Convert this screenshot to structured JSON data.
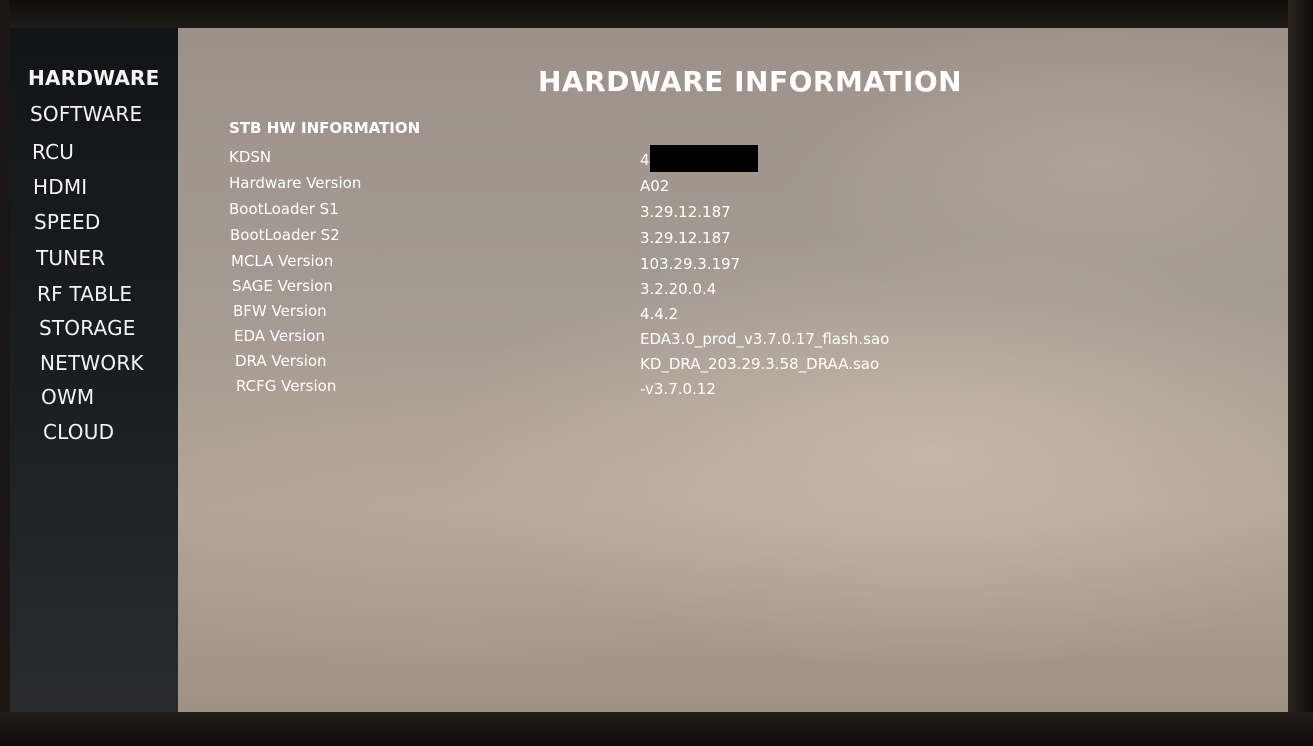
{
  "sidebar": {
    "items": [
      {
        "label": "HARDWARE",
        "active": true
      },
      {
        "label": "SOFTWARE"
      },
      {
        "label": "RCU"
      },
      {
        "label": "HDMI"
      },
      {
        "label": "SPEED"
      },
      {
        "label": "TUNER"
      },
      {
        "label": "RF TABLE"
      },
      {
        "label": "STORAGE"
      },
      {
        "label": "NETWORK"
      },
      {
        "label": "OWM"
      },
      {
        "label": "CLOUD"
      }
    ]
  },
  "page": {
    "title": "HARDWARE INFORMATION"
  },
  "section": {
    "title": "STB HW INFORMATION",
    "rows": [
      {
        "label": "KDSN",
        "value": "4"
      },
      {
        "label": "Hardware Version",
        "value": "A02"
      },
      {
        "label": "BootLoader S1",
        "value": "3.29.12.187"
      },
      {
        "label": "BootLoader S2",
        "value": "3.29.12.187"
      },
      {
        "label": "MCLA Version",
        "value": "103.29.3.197"
      },
      {
        "label": "SAGE Version",
        "value": "3.2.20.0.4"
      },
      {
        "label": "BFW Version",
        "value": "4.4.2"
      },
      {
        "label": "EDA Version",
        "value": "EDA3.0_prod_v3.7.0.17_flash.sao"
      },
      {
        "label": "DRA Version",
        "value": "KD_DRA_203.29.3.58_DRAA.sao"
      },
      {
        "label": "RCFG Version",
        "value": "-v3.7.0.12"
      }
    ]
  }
}
